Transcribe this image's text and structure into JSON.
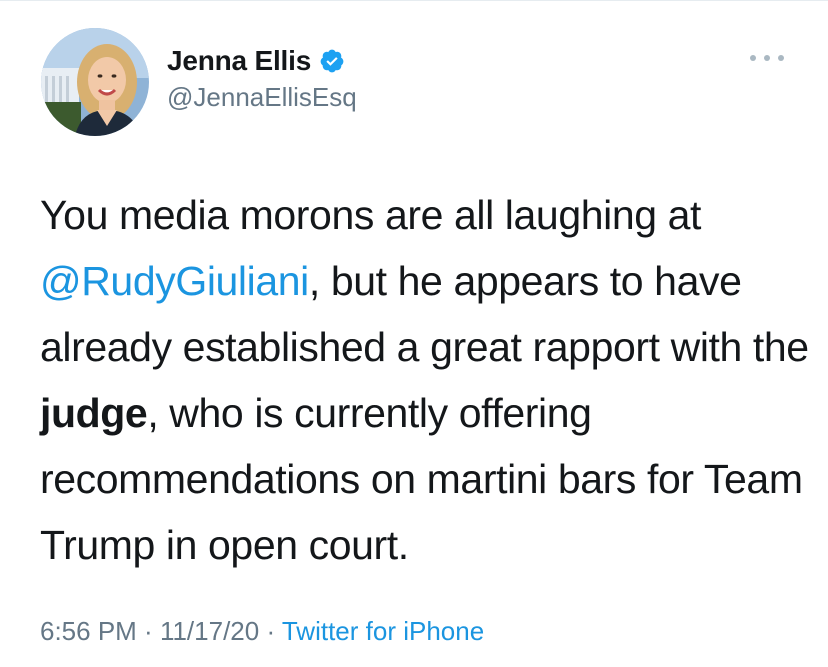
{
  "tweet": {
    "author": {
      "display_name": "Jenna Ellis",
      "handle": "@JennaEllisEsq",
      "verified": true
    },
    "text": {
      "seg1": "You media morons are all laughing at ",
      "mention": "@RudyGiuliani",
      "seg2": ", but he appears to have already established a great rapport with the ",
      "bold": "judge",
      "seg3": ", who is currently offering recommendations on martini bars for Team Trump in open court."
    },
    "meta": {
      "time": "6:56 PM",
      "separator1": " · ",
      "date": "11/17/20",
      "separator2": " · ",
      "source": "Twitter for iPhone"
    }
  },
  "icons": {
    "verified": "verified-badge-icon",
    "more": "more-options-icon"
  },
  "colors": {
    "link": "#1b95e0",
    "secondary_text": "#657786",
    "primary_text": "#14171a",
    "more_dots": "#aab8c2"
  }
}
